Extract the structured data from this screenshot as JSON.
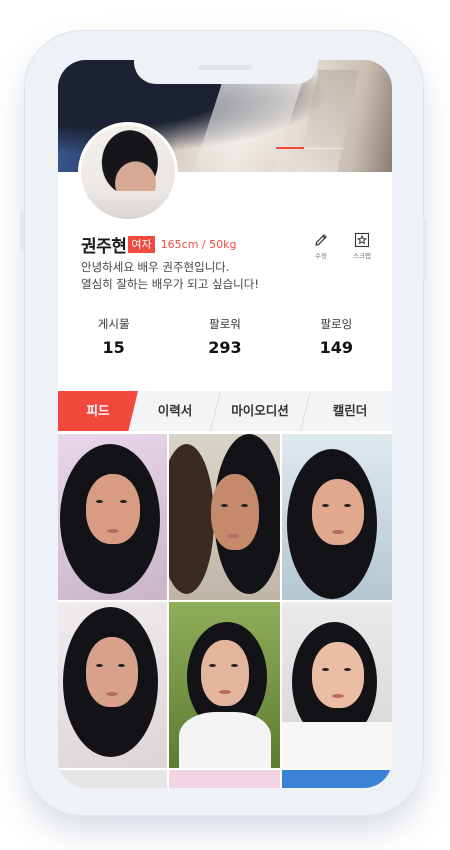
{
  "profile": {
    "name": "권주현",
    "gender": "여자",
    "height_weight": "165cm / 50kg",
    "bio_line1": "안녕하세요 배우 권주현입니다.",
    "bio_line2": "열심히 잘하는 배우가 되고 싶습니다!"
  },
  "actions": {
    "edit_label": "수정",
    "scrap_label": "스크랩"
  },
  "stats": [
    {
      "label": "게시물",
      "value": "15"
    },
    {
      "label": "팔로워",
      "value": "293"
    },
    {
      "label": "팔로잉",
      "value": "149"
    }
  ],
  "tabs": [
    {
      "label": "피드",
      "active": true
    },
    {
      "label": "이력서",
      "active": false
    },
    {
      "label": "마이오디션",
      "active": false
    },
    {
      "label": "캘린더",
      "active": false
    }
  ],
  "colors": {
    "accent": "#f2483d",
    "tab_bg": "#f3f4f6",
    "frame": "#eef1f6"
  },
  "icons": {
    "edit": "pencil-icon",
    "scrap": "star-bookmark-icon"
  },
  "feed_photos": [
    {
      "label": "feed-photo-1"
    },
    {
      "label": "feed-photo-2"
    },
    {
      "label": "feed-photo-3"
    },
    {
      "label": "feed-photo-4"
    },
    {
      "label": "feed-photo-5"
    },
    {
      "label": "feed-photo-6"
    }
  ]
}
